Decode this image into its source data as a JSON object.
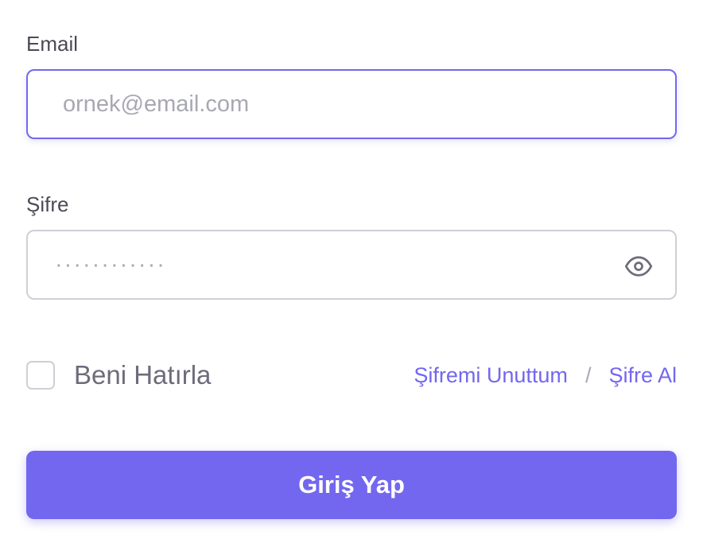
{
  "form": {
    "email": {
      "label": "Email",
      "placeholder": "ornek@email.com",
      "value": ""
    },
    "password": {
      "label": "Şifre",
      "placeholder": "············",
      "value": "",
      "toggle_icon": "eye-icon"
    },
    "remember": {
      "label": "Beni Hatırla",
      "checked": false
    },
    "links": {
      "forgot": "Şifremi Unuttum",
      "separator": "/",
      "get_password": "Şifre Al"
    },
    "submit_label": "Giriş Yap"
  },
  "colors": {
    "accent": "#7367f0",
    "border": "#cfcfd6",
    "text": "#4b4b57",
    "placeholder": "#a8a8b3"
  }
}
